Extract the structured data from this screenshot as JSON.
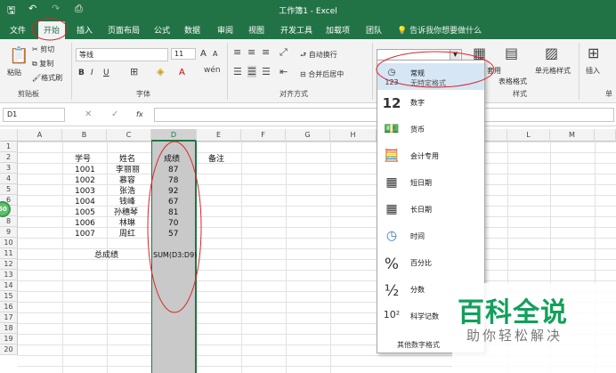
{
  "window": {
    "title": "工作簿1 - Excel"
  },
  "tabs": [
    "文件",
    "开始",
    "插入",
    "页面布局",
    "公式",
    "数据",
    "审阅",
    "视图",
    "开发工具",
    "加载项",
    "团队"
  ],
  "tell_me": "告诉我你想要做什么",
  "clipboard": {
    "paste": "粘贴",
    "cut": "剪切",
    "copy": "复制",
    "format_painter": "格式刷",
    "label": "剪贴板"
  },
  "font": {
    "name": "等线",
    "size": "11",
    "bold": "B",
    "italic": "I",
    "underline": "U",
    "grow": "A",
    "label": "字体"
  },
  "alignment": {
    "wrap": "自动换行",
    "merge": "合并后居中",
    "label": "对齐方式"
  },
  "styles": {
    "table": "套用",
    "table2": "表格格式",
    "cell_styles": "单元格样式",
    "label": "样式"
  },
  "cells": {
    "insert": "插入",
    "label": "单"
  },
  "formula_bar": {
    "name_box": "D1",
    "fx": "fx"
  },
  "columns": [
    "A",
    "B",
    "C",
    "D",
    "E",
    "F",
    "G",
    "H",
    "L",
    "M"
  ],
  "rows": [
    "1",
    "2",
    "3",
    "4",
    "5",
    "6",
    "7",
    "8",
    "9",
    "10",
    "11",
    "12",
    "13",
    "14",
    "15",
    "16",
    "17",
    "18",
    "19",
    "20"
  ],
  "sheet": {
    "headers": {
      "id": "学号",
      "name": "姓名",
      "score": "成绩",
      "note": "备注"
    },
    "records": [
      {
        "id": "1001",
        "name": "李丽丽",
        "score": "87"
      },
      {
        "id": "1002",
        "name": "慕容",
        "score": "78"
      },
      {
        "id": "1003",
        "name": "张浩",
        "score": "92"
      },
      {
        "id": "1004",
        "name": "钱峰",
        "score": "67"
      },
      {
        "id": "1005",
        "name": "孙穗琴",
        "score": "81"
      },
      {
        "id": "1006",
        "name": "林琳",
        "score": "70"
      },
      {
        "id": "1007",
        "name": "周红",
        "score": "57"
      }
    ],
    "total_label": "总成绩",
    "total_formula": "SUM(D3:D9)"
  },
  "side_badge": "50",
  "number_format_menu": {
    "items": [
      {
        "icon": "clock-123-icon",
        "label": "常规",
        "sub": "无特定格式"
      },
      {
        "icon": "number-12-icon",
        "label": "数字",
        "sub": ""
      },
      {
        "icon": "currency-icon",
        "label": "货币",
        "sub": ""
      },
      {
        "icon": "accounting-icon",
        "label": "会计专用",
        "sub": ""
      },
      {
        "icon": "short-date-icon",
        "label": "短日期",
        "sub": ""
      },
      {
        "icon": "long-date-icon",
        "label": "长日期",
        "sub": ""
      },
      {
        "icon": "time-icon",
        "label": "时间",
        "sub": ""
      },
      {
        "icon": "percent-icon",
        "label": "百分比",
        "sub": ""
      },
      {
        "icon": "fraction-icon",
        "label": "分数",
        "sub": ""
      },
      {
        "icon": "scientific-icon",
        "label": "科学记数",
        "sub": ""
      }
    ],
    "more": "其他数字格式"
  },
  "watermark": {
    "title": "百科全说",
    "subtitle": "助你轻松解决"
  },
  "colors": {
    "excel_green": "#217346",
    "annotation_red": "#d9262a",
    "watermark_green": "#12a05a"
  }
}
